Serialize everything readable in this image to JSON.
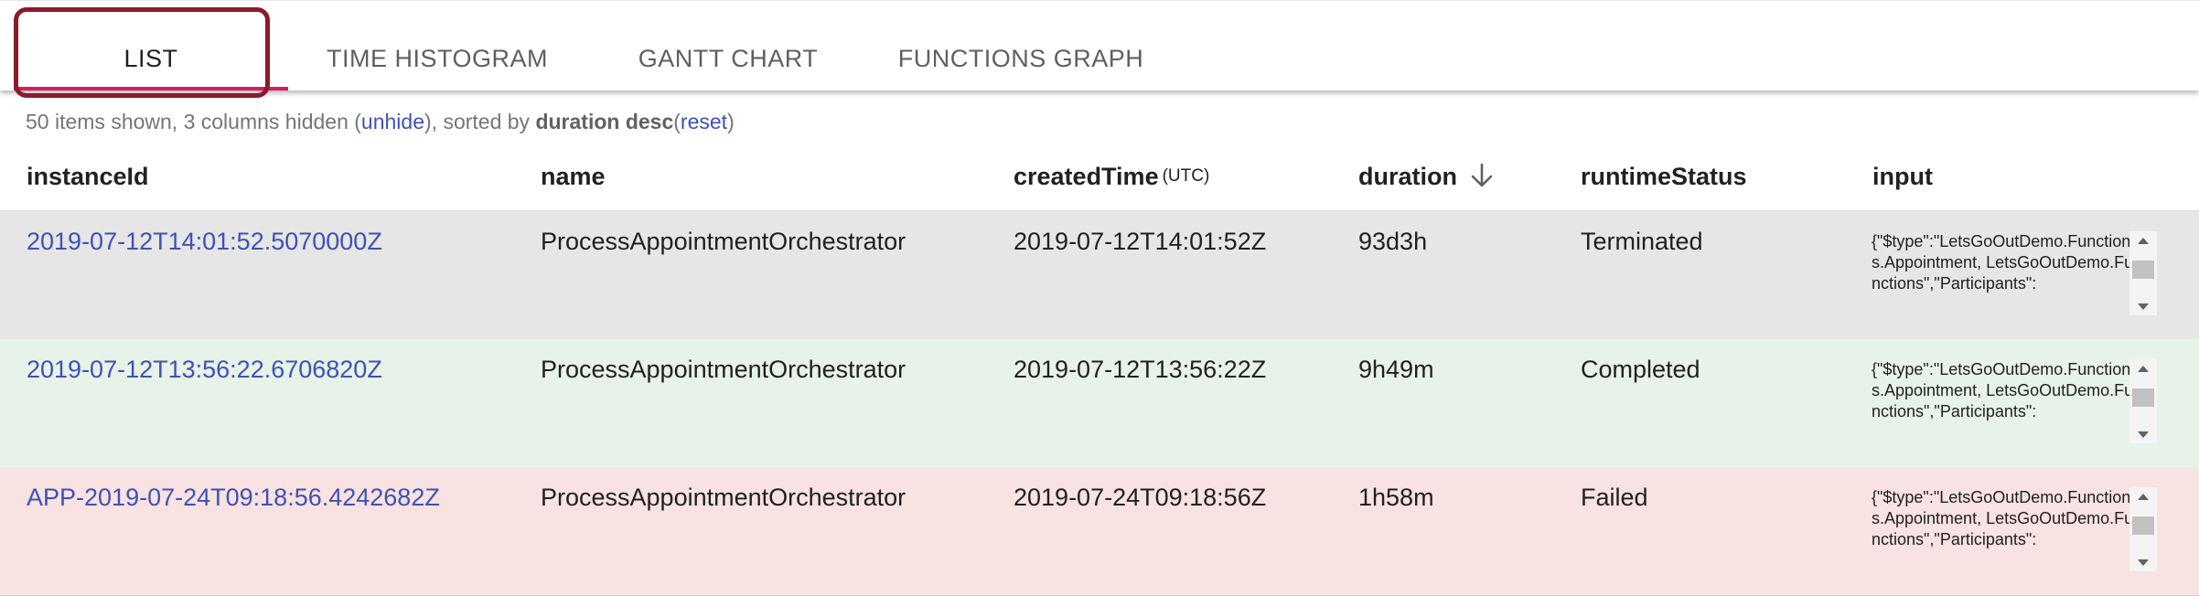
{
  "tabs": [
    {
      "label": "LIST",
      "active": true
    },
    {
      "label": "TIME HISTOGRAM",
      "active": false
    },
    {
      "label": "GANTT CHART",
      "active": false
    },
    {
      "label": "FUNCTIONS GRAPH",
      "active": false
    }
  ],
  "summary": {
    "prefix": "50 items shown, 3 columns hidden (",
    "unhide": "unhide",
    "middle": "), sorted by ",
    "sort_field": "duration desc",
    "open_paren": "(",
    "reset": "reset",
    "close_paren": ")"
  },
  "columns": {
    "instanceId": "instanceId",
    "name": "name",
    "createdTime": "createdTime",
    "createdTime_unit": "(UTC)",
    "duration": "duration",
    "runtimeStatus": "runtimeStatus",
    "input": "input"
  },
  "rows": [
    {
      "instanceId": "2019-07-12T14:01:52.5070000Z",
      "name": "ProcessAppointmentOrchestrator",
      "createdTime": "2019-07-12T14:01:52Z",
      "duration": "93d3h",
      "runtimeStatus": "Terminated",
      "input": "{\"$type\":\"LetsGoOutDemo.Functions.Appointment, LetsGoOutDemo.Functions\",\"Participants\":",
      "background": "#e6e6e6"
    },
    {
      "instanceId": "2019-07-12T13:56:22.6706820Z",
      "name": "ProcessAppointmentOrchestrator",
      "createdTime": "2019-07-12T13:56:22Z",
      "duration": "9h49m",
      "runtimeStatus": "Completed",
      "input": "{\"$type\":\"LetsGoOutDemo.Functions.Appointment, LetsGoOutDemo.Functions\",\"Participants\":",
      "background": "#e7f3e8"
    },
    {
      "instanceId": "APP-2019-07-24T09:18:56.4242682Z",
      "name": "ProcessAppointmentOrchestrator",
      "createdTime": "2019-07-24T09:18:56Z",
      "duration": "1h58m",
      "runtimeStatus": "Failed",
      "input": "{\"$type\":\"LetsGoOutDemo.Functions.Appointment, LetsGoOutDemo.Functions\",\"Participants\":",
      "background": "#f8e2e2"
    }
  ],
  "colors": {
    "link": "#3f51b5",
    "tab_indicator": "#d81b60",
    "highlight_border": "#8b1a2b"
  }
}
